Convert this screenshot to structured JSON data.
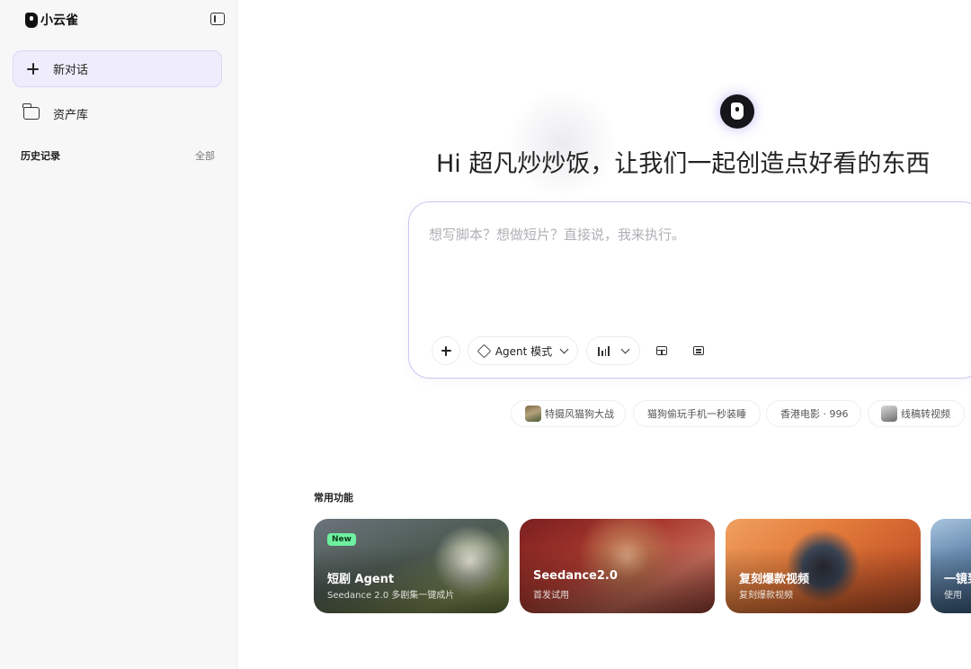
{
  "app": {
    "brand_name": "小云雀"
  },
  "sidebar": {
    "new_chat_label": "新对话",
    "assets_label": "资产库",
    "history_title": "历史记录",
    "history_all": "全部"
  },
  "main": {
    "greeting": "Hi 超凡炒炒饭，让我们一起创造点好看的东西",
    "prompt_placeholder": "想写脚本？想做短片？直接说，我来执行。",
    "toolbar": {
      "agent_mode_label": "Agent 模式"
    },
    "suggestions": [
      {
        "label": "特摄风猫狗大战",
        "has_thumb": true
      },
      {
        "label": "猫狗偷玩手机一秒装睡",
        "has_thumb": false
      },
      {
        "label": "香港电影 · 996",
        "has_thumb": false
      },
      {
        "label": "线稿转视频",
        "has_thumb": true
      }
    ],
    "features": {
      "title": "常用功能",
      "items": [
        {
          "title": "短剧 Agent",
          "subtitle": "Seedance 2.0 多剧集一键成片",
          "badge": "New"
        },
        {
          "title": "Seedance2.0",
          "subtitle": "首发试用",
          "badge": ""
        },
        {
          "title": "复刻爆款视频",
          "subtitle": "复刻爆款视频",
          "badge": ""
        },
        {
          "title": "一镜到",
          "subtitle": "使用",
          "badge": ""
        }
      ]
    }
  },
  "colors": {
    "accent": "#cbc6f2",
    "new_chat_bg": "#efedfb",
    "new_badge": "#6ef0a0"
  }
}
